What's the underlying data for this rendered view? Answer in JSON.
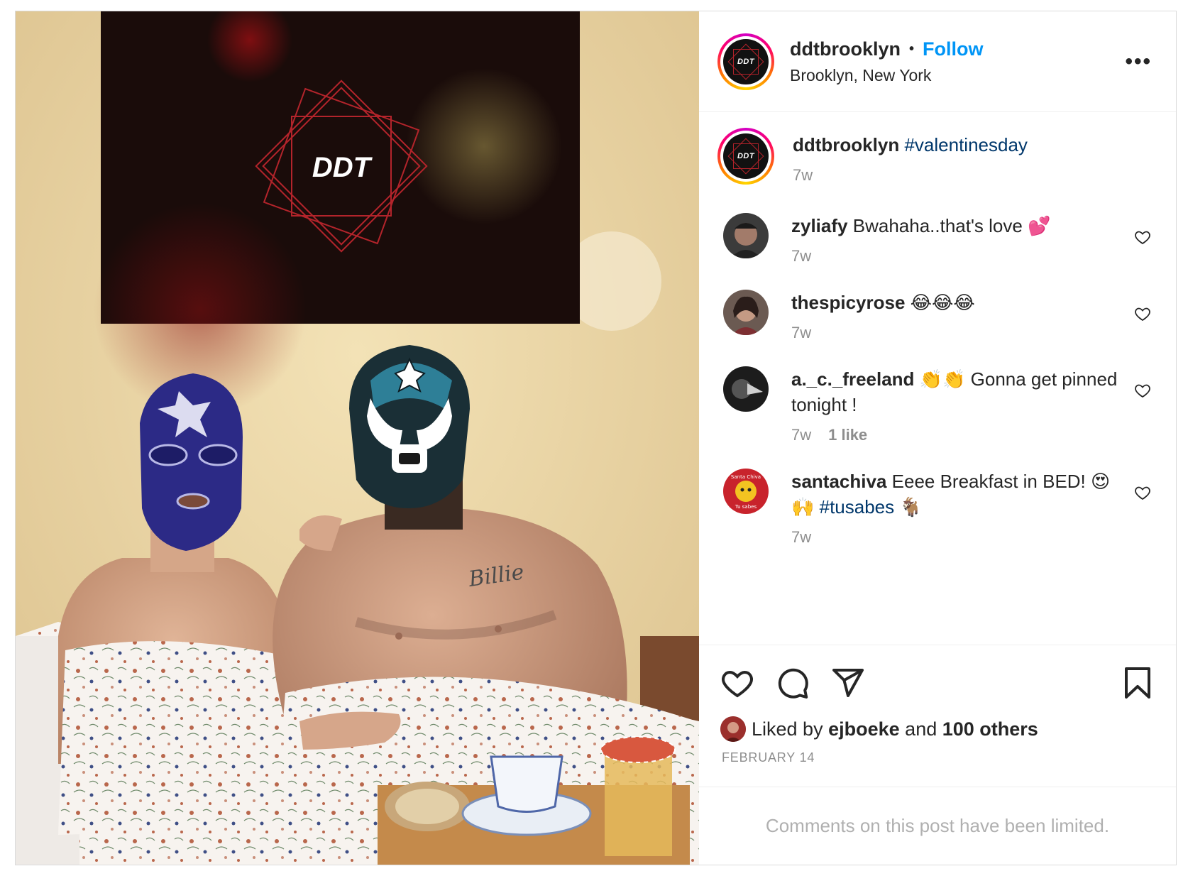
{
  "post": {
    "image": {
      "sign_text": "DDT",
      "tattoo_text": "Billie"
    },
    "header": {
      "username": "ddtbrooklyn",
      "separator": "•",
      "follow_label": "Follow",
      "location": "Brooklyn, New York",
      "more_label": "•••",
      "avatar_text": "DDT"
    },
    "caption": {
      "username": "ddtbrooklyn",
      "text": "#valentinesday",
      "time": "7w",
      "avatar_text": "DDT"
    },
    "comments": [
      {
        "username": "zyliafy",
        "text": "Bwahaha..that's love 💕",
        "time": "7w",
        "likes": ""
      },
      {
        "username": "thespicyrose",
        "text": "😂😂😂",
        "time": "7w",
        "likes": ""
      },
      {
        "username": "a._c._freeland",
        "text": "👏👏 Gonna get pinned tonight !",
        "time": "7w",
        "likes": "1 like"
      },
      {
        "username": "santachiva",
        "text": "Eeee Breakfast in BED! 😍🙌",
        "hashtag": "#tusabes",
        "emoji_end": "🐐",
        "time": "7w",
        "likes": "",
        "avatar_top": "Santa Chiva",
        "avatar_bottom": "Tu sabes"
      }
    ],
    "likes": {
      "prefix": "Liked by",
      "user": "ejboeke",
      "and": "and",
      "others": "100 others"
    },
    "date": "FEBRUARY 14",
    "comments_limited": "Comments on this post have been limited.",
    "icons": [
      "heart-icon",
      "comment-icon",
      "share-icon",
      "bookmark-icon",
      "more-icon"
    ],
    "colors": {
      "follow": "#0095f6",
      "hashtag": "#00376b",
      "muted": "#8e8e8e"
    }
  }
}
